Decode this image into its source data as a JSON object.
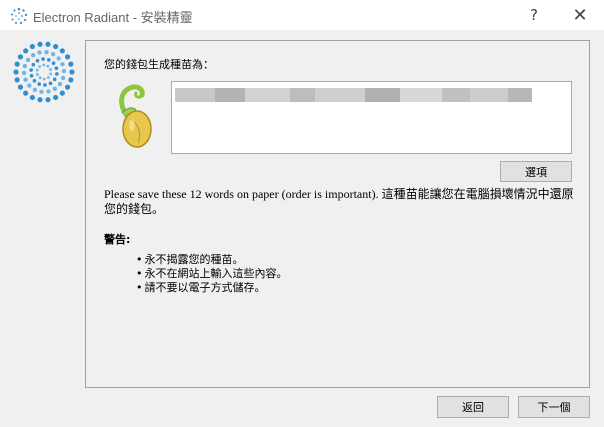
{
  "window": {
    "title": "Electron Radiant  -  安裝精靈",
    "help_glyph": "?",
    "close_glyph": "✕"
  },
  "seed_page": {
    "heading": "您的錢包生成種苗為：",
    "options_label": "選項",
    "instruction": "Please save these 12 words on paper (order is important). 這種苗能讓您在電腦損壞情況中還原您的錢包。",
    "warning_label": "警告:",
    "warnings": [
      "永不揭露您的種苗。",
      "永不在網站上輸入這些內容。",
      "請不要以電子方式儲存。"
    ]
  },
  "footer": {
    "back_label": "返回",
    "next_label": "下一個"
  },
  "colors": {
    "logo_blue": "#2f8fcf",
    "seed_green": "#7cb342",
    "seed_yellow": "#e8c84a"
  },
  "icons": {
    "app": "electron-radiant-logo-icon",
    "brand": "electron-radiant-logo-icon",
    "seed": "sprouting-seed-icon"
  }
}
